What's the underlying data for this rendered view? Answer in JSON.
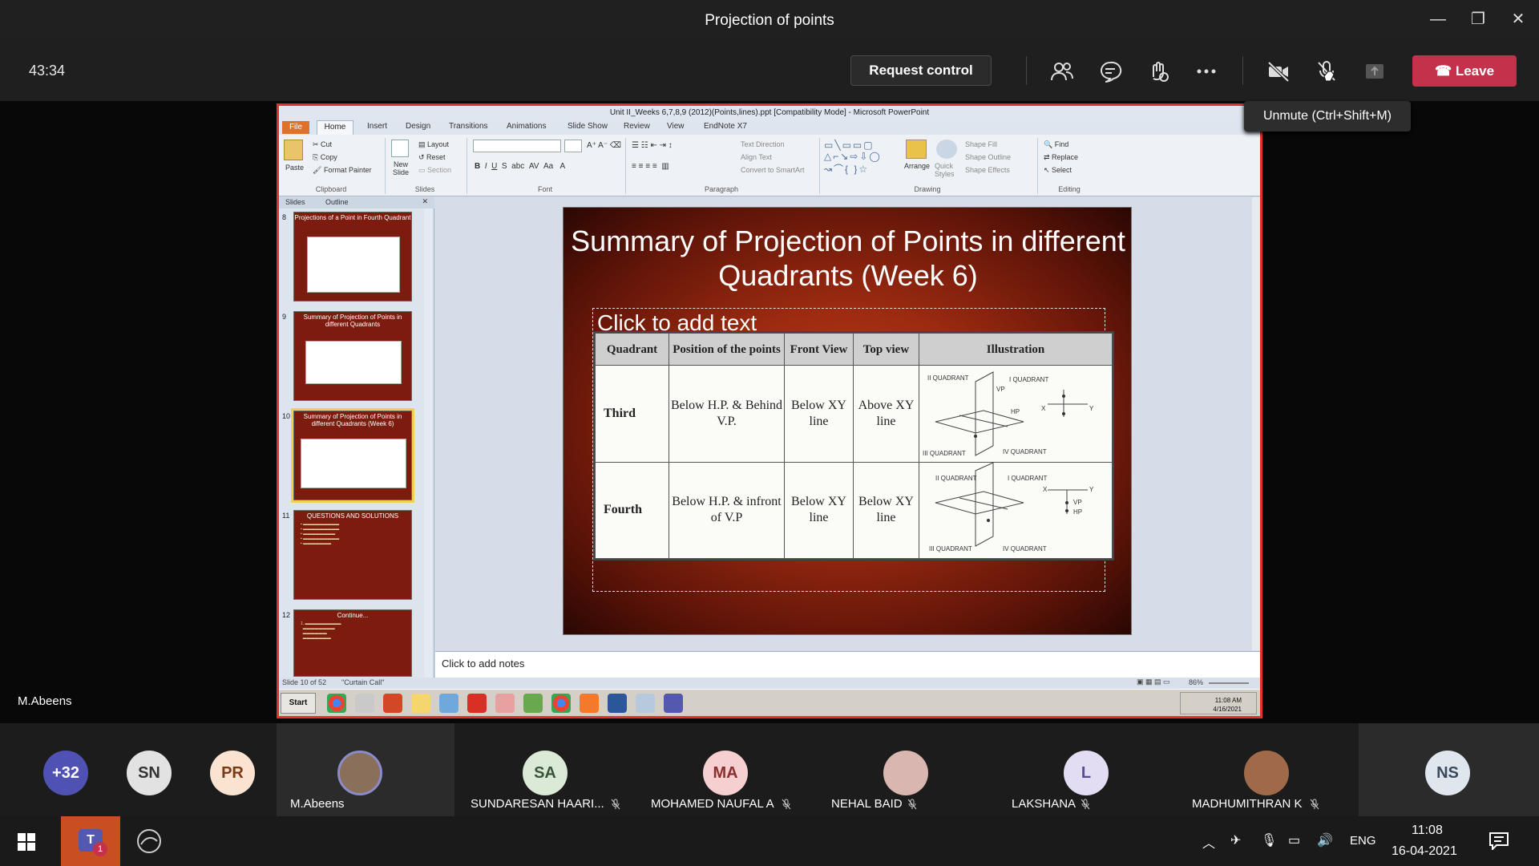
{
  "window": {
    "title": "Projection of points"
  },
  "call": {
    "timer": "43:34",
    "request_control": "Request control",
    "leave": "Leave",
    "tooltip": "Unmute (Ctrl+Shift+M)",
    "presenter_name": "M.Abeens",
    "colors": {
      "leave": "#c4314b",
      "share_border": "#e0312f"
    }
  },
  "ppt": {
    "title": "Unit II_Weeks 6,7,8,9 (2012)(Points,lines).ppt [Compatibility Mode] - Microsoft PowerPoint",
    "tabs": [
      "File",
      "Home",
      "Insert",
      "Design",
      "Transitions",
      "Animations",
      "Slide Show",
      "Review",
      "View",
      "EndNote X7"
    ],
    "ribbon": {
      "clipboard": {
        "paste": "Paste",
        "cut": "Cut",
        "copy": "Copy",
        "format_painter": "Format Painter",
        "group": "Clipboard"
      },
      "slides": {
        "new_slide": "New Slide",
        "layout": "Layout",
        "reset": "Reset",
        "section": "Section",
        "group": "Slides"
      },
      "font_group": "Font",
      "paragraph": {
        "text_direction": "Text Direction",
        "align_text": "Align Text",
        "convert": "Convert to SmartArt",
        "group": "Paragraph"
      },
      "drawing": {
        "arrange": "Arrange",
        "quick_styles": "Quick Styles",
        "shape_fill": "Shape Fill",
        "shape_outline": "Shape Outline",
        "shape_effects": "Shape Effects",
        "group": "Drawing"
      },
      "editing": {
        "find": "Find",
        "replace": "Replace",
        "select": "Select",
        "group": "Editing"
      }
    },
    "panel_tabs": [
      "Slides",
      "Outline"
    ],
    "thumbnails": [
      {
        "num": "8",
        "title": "Projections of a Point in Fourth Quadrant"
      },
      {
        "num": "9",
        "title": "Summary of Projection of Points in different Quadrants"
      },
      {
        "num": "10",
        "title": "Summary of Projection of Points in different Quadrants (Week 6)"
      },
      {
        "num": "11",
        "title": "QUESTIONS AND SOLUTIONS"
      },
      {
        "num": "12",
        "title": "Continue..."
      }
    ],
    "slide": {
      "title": "Summary of Projection of Points in different Quadrants (Week 6)",
      "placeholder": "Click to add text",
      "table": {
        "headers": [
          "Quadrant",
          "Position of the points",
          "Front View",
          "Top view",
          "Illustration"
        ],
        "rows": [
          {
            "quadrant": "Third",
            "position": "Below H.P. & Behind V.P.",
            "front": "Below XY line",
            "top": "Above XY line"
          },
          {
            "quadrant": "Fourth",
            "position": "Below H.P. & infront of V.P",
            "front": "Below XY line",
            "top": "Below XY line"
          }
        ],
        "illus_labels": {
          "q1": "I QUADRANT",
          "q2": "II QUADRANT",
          "q3": "III QUADRANT",
          "q4": "IV QUADRANT",
          "vp": "VP",
          "hp": "HP",
          "x": "X",
          "y": "Y"
        }
      }
    },
    "notes": "Click to add notes",
    "status": {
      "slide_count": "Slide 10 of 52",
      "theme": "\"Curtain Call\"",
      "zoom": "86%"
    },
    "xp": {
      "start": "Start",
      "time": "11:08 AM",
      "date": "4/16/2021"
    }
  },
  "participants": [
    {
      "initials": "+32",
      "name": "",
      "color": "#4f52b2",
      "text": "#fff"
    },
    {
      "initials": "SN",
      "name": "",
      "color": "#e2e2e2",
      "text": "#333"
    },
    {
      "initials": "PR",
      "name": "",
      "color": "#fbe3d1",
      "text": "#7a3b14"
    },
    {
      "initials": "",
      "name": "M.Abeens",
      "color": "#8a6f5a",
      "text": "#fff"
    },
    {
      "initials": "SA",
      "name": "SUNDARESAN HAARI...",
      "color": "#dbe9d7",
      "text": "#37553a"
    },
    {
      "initials": "MA",
      "name": "MOHAMED NAUFAL A",
      "color": "#f6d0d0",
      "text": "#8a2d2d"
    },
    {
      "initials": "",
      "name": "NEHAL BAID",
      "color": "#d9b6b0",
      "text": "#fff"
    },
    {
      "initials": "L",
      "name": "LAKSHANA",
      "color": "#e3ddf4",
      "text": "#5b4a91"
    },
    {
      "initials": "",
      "name": "MADHUMITHRAN K",
      "color": "#a06a4a",
      "text": "#fff"
    },
    {
      "initials": "NS",
      "name": "",
      "color": "#dfe6ee",
      "text": "#3a4a5c"
    }
  ],
  "system": {
    "lang": "ENG",
    "time": "11:08",
    "date": "16-04-2021",
    "teams_badge": "1"
  }
}
